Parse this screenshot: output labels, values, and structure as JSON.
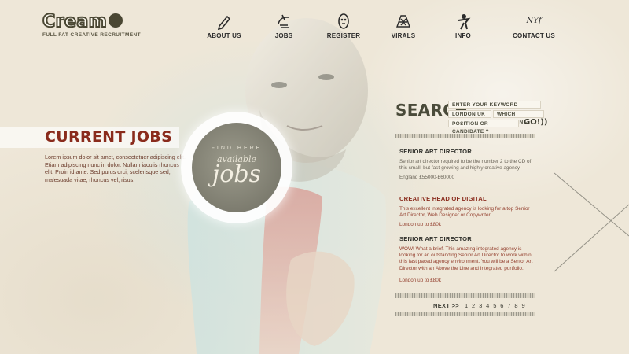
{
  "logo": {
    "word": "Cream",
    "plus": "+",
    "tagline": "FULL FAT CREATIVE RECRUITMENT"
  },
  "nav": [
    {
      "label": "ABOUT US",
      "icon": "pencil-icon"
    },
    {
      "label": "JOBS",
      "icon": "hand-icon"
    },
    {
      "label": "REGISTER",
      "icon": "mask-icon"
    },
    {
      "label": "VIRALS",
      "icon": "helmet-icon"
    },
    {
      "label": "INFO",
      "icon": "figure-icon"
    },
    {
      "label": "CONTACT US",
      "icon": "nyf-logo-icon",
      "icon_text": "NYf"
    }
  ],
  "current_jobs": {
    "title": "CURRENT JOBS",
    "text": "Lorem ipsum dolor sit amet, consectetuer adipiscing elit. Etiam adipiscing nunc in dolor. Nullam iaculis rhoncus elit. Proin id ante. Sed purus orci, scelerisque sed, malesuada vitae, rhoncus vel, risus."
  },
  "badge": {
    "line1": "FIND HERE",
    "line2": "available",
    "line3": "jobs"
  },
  "search": {
    "title": "SEARCH",
    "keyword_placeholder": "ENTER YOUR KEYWORD",
    "location_value": "LONDON UK",
    "position_value": "WHICH POSITION",
    "type_placeholder": "POSITION OR CANDIDATE ?",
    "go_label": "GO!))"
  },
  "jobs": [
    {
      "title": "SENIOR ART DIRECTOR",
      "desc": "Senior art director required to be the number 2 to the CD of this small, but fast-growing and highly creative agency.",
      "salary": "England £55000-£60000"
    },
    {
      "title": "CREATIVE HEAD OF DIGITAL",
      "desc": "This excellent integrated agency is looking for a top Senior Art Director, Web Designer or Copywriter",
      "salary": "London up to £80k"
    },
    {
      "title": "SENIOR ART DIRECTOR",
      "desc": "WOW! What a brief. This amazing integrated agency is looking for an outstanding Senior Art Director to work within this fast paced agency environment. You will be a Senior Art Director with an Above the Line and Integrated portfolio.",
      "salary": "London up to £80k"
    }
  ],
  "pagination": {
    "next_label": "NEXT >>",
    "pages": "1 2 3 4 5 6 7 8 9"
  },
  "colors": {
    "background": "#eee7d8",
    "accent": "#8a2b1c",
    "text": "#2f2f2a"
  }
}
